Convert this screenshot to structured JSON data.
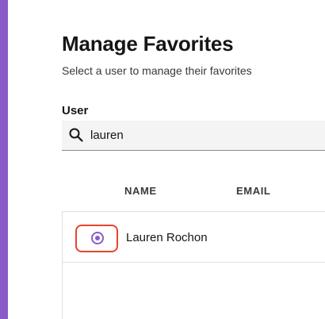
{
  "page": {
    "title": "Manage Favorites",
    "subtitle": "Select a user to manage their favorites"
  },
  "user_field": {
    "label": "User",
    "search_value": "lauren",
    "icon": "search-icon"
  },
  "table": {
    "headers": [
      "NAME",
      "EMAIL"
    ],
    "rows": [
      {
        "name": "Lauren Rochon",
        "email": "",
        "selected": true
      }
    ]
  },
  "colors": {
    "accent": "#8a5cc8",
    "highlight": "#e8432b",
    "search_bg": "#f4f4f4"
  }
}
